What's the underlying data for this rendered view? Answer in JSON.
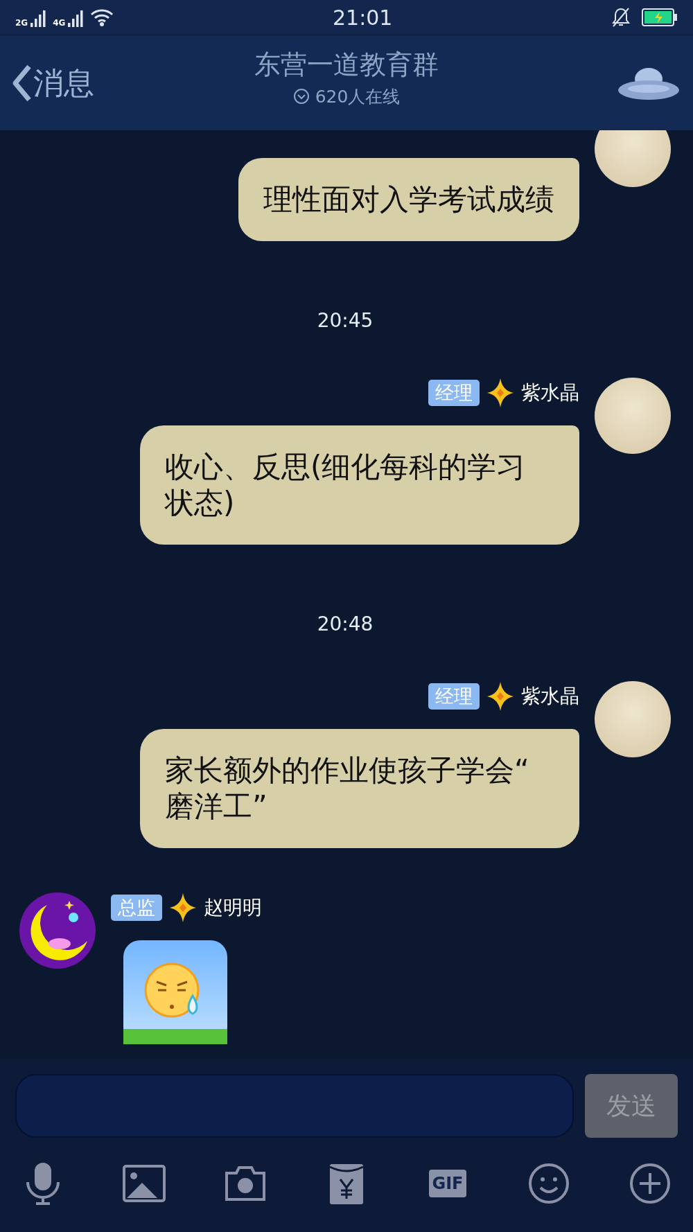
{
  "status_bar": {
    "network_1": "2G",
    "network_2": "4G",
    "time": "21:01"
  },
  "header": {
    "back": "消息",
    "title": "东营一道教育群",
    "subtitle": "620人在线"
  },
  "chat": [
    {
      "kind": "outgoing_message",
      "text": "理性面对入学考试成绩"
    },
    {
      "kind": "time",
      "text": "20:45"
    },
    {
      "kind": "outgoing_message",
      "role": "经理",
      "name": "紫水晶",
      "text": "收心、反思(细化每科的学习状态)"
    },
    {
      "kind": "time",
      "text": "20:48"
    },
    {
      "kind": "outgoing_message",
      "role": "经理",
      "name": "紫水晶",
      "text": "家长额外的作业使孩子学会“磨洋工”"
    },
    {
      "kind": "incoming_sticker",
      "role": "总监",
      "name": "赵明明"
    }
  ],
  "composer": {
    "send": "发送",
    "send_disabled": true
  },
  "gif_label": "GIF"
}
